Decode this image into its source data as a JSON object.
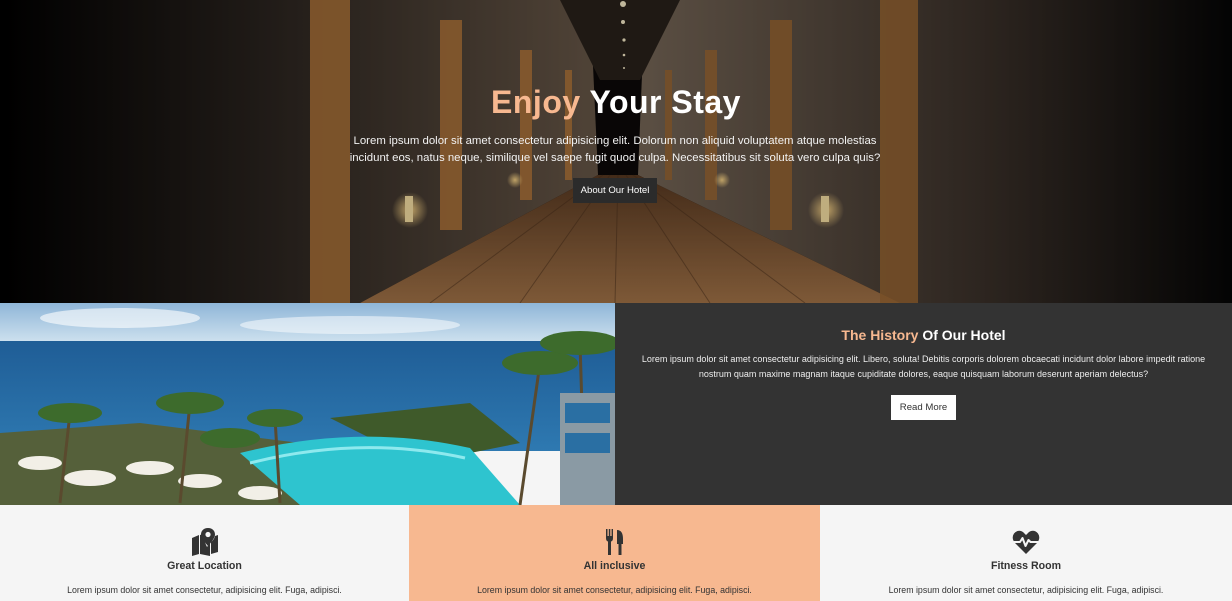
{
  "hero": {
    "title_accent": "Enjoy",
    "title_rest": " Your Stay",
    "text": "Lorem ipsum dolor sit amet consectetur adipisicing elit. Dolorum non aliquid voluptatem atque molestias incidunt eos, natus neque, similique vel saepe fugit quod culpa. Necessitatibus sit soluta vero culpa quis?",
    "button_label": "About Our Hotel"
  },
  "history": {
    "title_accent": "The History",
    "title_rest": " Of Our Hotel",
    "text": "Lorem ipsum dolor sit amet consectetur adipisicing elit. Libero, soluta! Debitis corporis dolorem obcaecati incidunt dolor labore impedit ratione nostrum quam maxime magnam itaque cupiditate dolores, eaque quisquam laborum deserunt aperiam delectus?",
    "button_label": "Read More"
  },
  "features": [
    {
      "icon": "map-marker-icon",
      "title": "Great Location",
      "text": "Lorem ipsum dolor sit amet consectetur, adipisicing elit. Fuga, adipisci."
    },
    {
      "icon": "utensils-icon",
      "title": "All inclusive",
      "text": "Lorem ipsum dolor sit amet consectetur, adipisicing elit. Fuga, adipisci."
    },
    {
      "icon": "heartbeat-icon",
      "title": "Fitness Room",
      "text": "Lorem ipsum dolor sit amet consectetur, adipisicing elit. Fuga, adipisci."
    }
  ],
  "colors": {
    "accent": "#f7b890",
    "dark_panel": "#333333",
    "hero_button": "#2b2b2b",
    "light_bg": "#f5f5f5"
  }
}
